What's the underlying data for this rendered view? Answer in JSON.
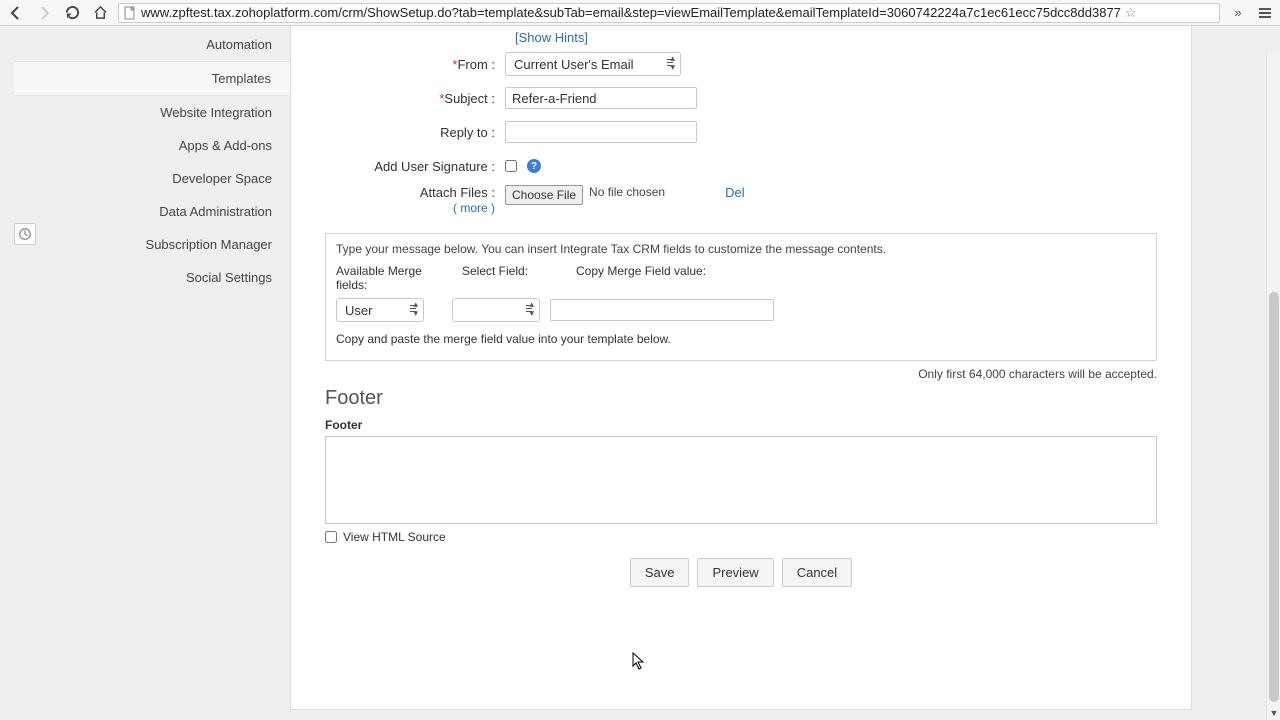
{
  "browser": {
    "url": "www.zpftest.tax.zohoplatform.com/crm/ShowSetup.do?tab=template&subTab=email&step=viewEmailTemplate&emailTemplateId=3060742224a7c1ec61ecc75dcc8dd3877"
  },
  "sidebar": {
    "items": [
      {
        "label": "Automation"
      },
      {
        "label": "Templates"
      },
      {
        "label": "Website Integration"
      },
      {
        "label": "Apps & Add-ons"
      },
      {
        "label": "Developer Space"
      },
      {
        "label": "Data Administration"
      },
      {
        "label": "Subscription Manager"
      },
      {
        "label": "Social Settings"
      }
    ],
    "selected_index": 1
  },
  "form": {
    "show_hints": "[Show Hints]",
    "from_label": "From :",
    "from_value": "Current User's Email",
    "subject_label": "Subject :",
    "subject_value": "Refer-a-Friend",
    "reply_to_label": "Reply to :",
    "reply_to_value": "",
    "signature_label": "Add User Signature :",
    "attach_label": "Attach Files :",
    "attach_more": "( more )",
    "choose_file": "Choose File",
    "no_file": "No file chosen",
    "del": "Del"
  },
  "merge": {
    "instruction": "Type your message below. You can insert Integrate Tax CRM fields to customize the message contents.",
    "h1": "Available Merge fields:",
    "h2": "Select Field:",
    "h3": "Copy Merge Field value:",
    "sel1": "User",
    "sel2": "",
    "field_value": "",
    "note": "Copy and paste the merge field value into your template below."
  },
  "limit_note": "Only first 64,000 characters will be accepted.",
  "footer": {
    "heading": "Footer",
    "label": "Footer"
  },
  "viewsrc_label": "View HTML Source",
  "buttons": {
    "save": "Save",
    "preview": "Preview",
    "cancel": "Cancel"
  }
}
